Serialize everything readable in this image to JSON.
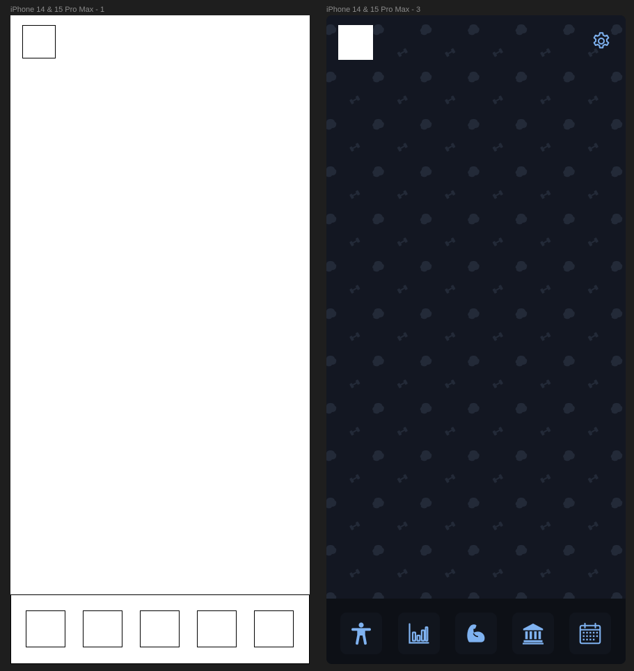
{
  "canvas": {
    "frames": [
      {
        "label": "iPhone 14 & 15 Pro Max - 1"
      },
      {
        "label": "iPhone 14 & 15 Pro Max - 3"
      }
    ]
  },
  "frame3": {
    "settings_icon": "gear-icon",
    "accent_color": "#7fb2f0",
    "background_color": "#131722",
    "tabs": [
      {
        "icon": "accessibility-icon"
      },
      {
        "icon": "bar-chart-icon"
      },
      {
        "icon": "flexed-bicep-icon"
      },
      {
        "icon": "bank-icon"
      },
      {
        "icon": "calendar-icon"
      }
    ]
  }
}
